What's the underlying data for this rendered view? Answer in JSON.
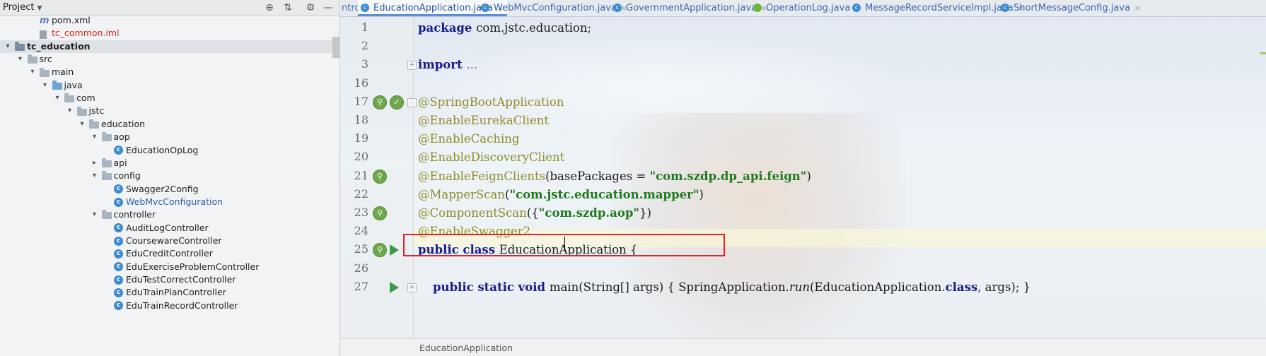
{
  "project_panel": {
    "title": "Project",
    "header_icons": [
      "globe-icon",
      "collapse-icon",
      "gear-icon",
      "minimize-icon"
    ],
    "tree": [
      {
        "label": "pom.xml",
        "icon": "maven-icon",
        "depth": 2,
        "style": "normal"
      },
      {
        "label": "tc_common.iml",
        "icon": "iml-icon",
        "depth": 2,
        "style": "red"
      },
      {
        "label": "tc_education",
        "icon": "module-folder-icon",
        "depth": 0,
        "style": "bold",
        "expanded": true
      },
      {
        "label": "src",
        "icon": "folder-icon",
        "depth": 1,
        "expanded": true
      },
      {
        "label": "main",
        "icon": "folder-icon",
        "depth": 2,
        "expanded": true
      },
      {
        "label": "java",
        "icon": "java-folder-icon",
        "depth": 3,
        "expanded": true
      },
      {
        "label": "com",
        "icon": "package-icon",
        "depth": 4,
        "expanded": true
      },
      {
        "label": "jstc",
        "icon": "package-icon",
        "depth": 5,
        "expanded": true
      },
      {
        "label": "education",
        "icon": "package-icon",
        "depth": 6,
        "expanded": true
      },
      {
        "label": "aop",
        "icon": "package-icon",
        "depth": 7,
        "expanded": true
      },
      {
        "label": "EducationOpLog",
        "icon": "class-icon",
        "depth": 8
      },
      {
        "label": "api",
        "icon": "package-icon",
        "depth": 7,
        "expanded": false
      },
      {
        "label": "config",
        "icon": "package-icon",
        "depth": 7,
        "expanded": true
      },
      {
        "label": "Swagger2Config",
        "icon": "class-icon",
        "depth": 8
      },
      {
        "label": "WebMvcConfiguration",
        "icon": "class-icon",
        "depth": 8,
        "style": "blue"
      },
      {
        "label": "controller",
        "icon": "package-icon",
        "depth": 7,
        "expanded": true
      },
      {
        "label": "AuditLogController",
        "icon": "class-icon",
        "depth": 8
      },
      {
        "label": "CoursewareController",
        "icon": "class-icon",
        "depth": 8
      },
      {
        "label": "EduCreditController",
        "icon": "class-icon",
        "depth": 8
      },
      {
        "label": "EduExerciseProblemController",
        "icon": "class-icon",
        "depth": 8
      },
      {
        "label": "EduTestCorrectController",
        "icon": "class-icon",
        "depth": 8
      },
      {
        "label": "EduTrainPlanController",
        "icon": "class-icon",
        "depth": 8
      },
      {
        "label": "EduTrainRecordController",
        "icon": "class-icon",
        "depth": 8
      }
    ]
  },
  "editor": {
    "tabs": [
      {
        "label": "ntroller.java",
        "icon": "",
        "active": false
      },
      {
        "label": "EducationApplication.java",
        "icon": "class-icon",
        "active": true
      },
      {
        "label": "WebMvcConfiguration.java",
        "icon": "class-icon",
        "active": false
      },
      {
        "label": "GovernmentApplication.java",
        "icon": "class-icon",
        "active": false
      },
      {
        "label": "OperationLog.java",
        "icon": "spring-icon",
        "active": false
      },
      {
        "label": "MessageRecordServiceImpl.java",
        "icon": "class-icon",
        "active": false
      },
      {
        "label": "ShortMessageConfig.java",
        "icon": "class-icon",
        "active": false
      }
    ],
    "tab_close_glyph": "×",
    "lines": [
      {
        "number": "1",
        "segments": [
          {
            "t": "package ",
            "c": "kw"
          },
          {
            "t": "com.jstc.education;",
            "c": ""
          }
        ]
      },
      {
        "number": "2",
        "segments": []
      },
      {
        "number": "3",
        "fold": "+",
        "segments": [
          {
            "t": "import ",
            "c": "kw"
          },
          {
            "t": "...",
            "c": "muted"
          }
        ]
      },
      {
        "number": "16",
        "segments": []
      },
      {
        "number": "17",
        "fold": "-",
        "gutter": "bean",
        "segments": [
          {
            "t": "@SpringBootApplication",
            "c": "ann"
          }
        ]
      },
      {
        "number": "18",
        "segments": [
          {
            "t": "@EnableEurekaClient",
            "c": "ann"
          }
        ]
      },
      {
        "number": "19",
        "segments": [
          {
            "t": "@EnableCaching",
            "c": "ann"
          }
        ]
      },
      {
        "number": "20",
        "segments": [
          {
            "t": "@EnableDiscoveryClient",
            "c": "ann"
          }
        ]
      },
      {
        "number": "21",
        "gutter": "bean",
        "segments": [
          {
            "t": "@EnableFeignClients",
            "c": "ann"
          },
          {
            "t": "(basePackages = ",
            "c": ""
          },
          {
            "t": "\"com.szdp.dp_api.feign\"",
            "c": "str"
          },
          {
            "t": ")",
            "c": ""
          }
        ]
      },
      {
        "number": "22",
        "segments": [
          {
            "t": "@MapperScan",
            "c": "ann"
          },
          {
            "t": "(",
            "c": ""
          },
          {
            "t": "\"com.jstc.education.mapper\"",
            "c": "str"
          },
          {
            "t": ")",
            "c": ""
          }
        ]
      },
      {
        "number": "23",
        "gutter": "bean",
        "highlight": true,
        "segments": [
          {
            "t": "@ComponentScan",
            "c": "ann"
          },
          {
            "t": "({",
            "c": ""
          },
          {
            "t": "\"com.szdp.aop\"",
            "c": "str"
          },
          {
            "t": "})",
            "c": ""
          }
        ]
      },
      {
        "number": "24",
        "segments": [
          {
            "t": "@EnableSwagger2",
            "c": "ann"
          }
        ]
      },
      {
        "number": "25",
        "gutter": "bean-run",
        "segments": [
          {
            "t": "public class ",
            "c": "kw"
          },
          {
            "t": "EducationApplication {",
            "c": ""
          }
        ]
      },
      {
        "number": "26",
        "segments": []
      },
      {
        "number": "27",
        "fold": "+",
        "gutter": "run",
        "segments": [
          {
            "t": "    ",
            "c": ""
          },
          {
            "t": "public static void ",
            "c": "kw"
          },
          {
            "t": "main(String[] args) { SpringApplication.",
            "c": ""
          },
          {
            "t": "run",
            "c": "em"
          },
          {
            "t": "(EducationApplication.",
            "c": ""
          },
          {
            "t": "class",
            "c": "kw"
          },
          {
            "t": ", args); }",
            "c": ""
          }
        ]
      }
    ],
    "breadcrumb": "EducationApplication",
    "colors": {
      "highlight_box": "#e0242a",
      "annotation": "#8d8d2a",
      "string": "#1e7a1e",
      "keyword": "#1a1a8a"
    }
  }
}
